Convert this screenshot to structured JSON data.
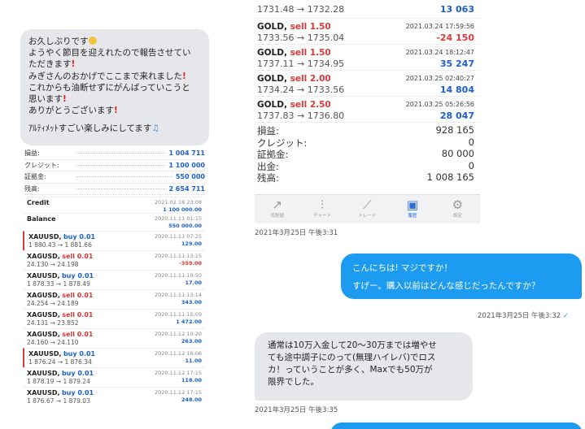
{
  "left_message": {
    "lines": [
      {
        "text": "お久しぶりです",
        "suffix": "smile"
      },
      {
        "text": "ようやく節目を迎えれたので報告させてい"
      },
      {
        "text": "ただきます",
        "suffix": "bang"
      },
      {
        "text": "みぎさんのおかげでここまで来れました",
        "suffix": "bang"
      },
      {
        "text": "これからも油断せずにがんばっていこうと"
      },
      {
        "text": "思います",
        "suffix": "bang"
      },
      {
        "text": "ありがとうございます",
        "suffix": "bang"
      },
      {
        "text": ""
      },
      {
        "text": "ｱﾙﾃｨﾒｯﾄすごい楽しみにしてます",
        "suffix": "note"
      }
    ]
  },
  "left_summary": [
    {
      "label": "損益:",
      "value": "1 004 711"
    },
    {
      "label": "クレジット:",
      "value": "1 100 000"
    },
    {
      "label": "証拠金:",
      "value": "550 000"
    },
    {
      "label": "残高:",
      "value": "2 654 711"
    }
  ],
  "left_history": [
    {
      "name": "Credit",
      "action": "",
      "action_color": "",
      "sub": "",
      "date": "2021.02.18 23:08",
      "amount": "1 100 000.00",
      "amount_color": "blue",
      "marked": false
    },
    {
      "name": "Balance",
      "action": "",
      "action_color": "",
      "sub": "",
      "date": "2020.11.11 01:15",
      "amount": "550 000.00",
      "amount_color": "blue",
      "marked": false
    },
    {
      "name": "XAUUSD,",
      "action": "buy 0.01",
      "action_color": "blue",
      "sub": "1 880.43 → 1 881.66",
      "date": "2020.11.11 07:25",
      "amount": "129.00",
      "amount_color": "blue",
      "marked": true
    },
    {
      "name": "XAGUSD,",
      "action": "sell 0.01",
      "action_color": "red",
      "sub": "24.130 → 24.198",
      "date": "2020.11.11 13:15",
      "amount": "-359.00",
      "amount_color": "red",
      "marked": false
    },
    {
      "name": "XAUUSD,",
      "action": "buy 0.01",
      "action_color": "blue",
      "sub": "1 878.33 → 1 878.49",
      "date": "2020.11.11 19:50",
      "amount": "17.00",
      "amount_color": "blue",
      "marked": false
    },
    {
      "name": "XAGUSD,",
      "action": "sell 0.01",
      "action_color": "red",
      "sub": "24.254 → 24.189",
      "date": "2020.11.11 13:14",
      "amount": "343.00",
      "amount_color": "blue",
      "marked": false
    },
    {
      "name": "XAGUSD,",
      "action": "sell 0.01",
      "action_color": "red",
      "sub": "24.131 → 23.852",
      "date": "2020.11.11 15:09",
      "amount": "1 472.00",
      "amount_color": "blue",
      "marked": false
    },
    {
      "name": "XAGUSD,",
      "action": "sell 0.01",
      "action_color": "red",
      "sub": "24.160 → 24.110",
      "date": "2020.11.12 10:20",
      "amount": "263.00",
      "amount_color": "blue",
      "marked": false
    },
    {
      "name": "XAUUSD,",
      "action": "buy 0.01",
      "action_color": "blue",
      "sub": "1 876.24 → 1 876.34",
      "date": "2020.11.12 16:06",
      "amount": "11.00",
      "amount_color": "blue",
      "marked": true
    },
    {
      "name": "XAUUSD,",
      "action": "buy 0.01",
      "action_color": "blue",
      "sub": "1 878.19 → 1 879.24",
      "date": "2020.11.12 17:15",
      "amount": "118.00",
      "amount_color": "blue",
      "marked": false
    },
    {
      "name": "XAUUSD,",
      "action": "buy 0.01",
      "action_color": "blue",
      "sub": "1 876.67 → 1 879.03",
      "date": "2020.11.12 17:15",
      "amount": "248.00",
      "amount_color": "blue",
      "marked": false
    }
  ],
  "mt4": {
    "first_row": {
      "prices": "1731.48 → 1732.28",
      "amount": "13 063"
    },
    "positions": [
      {
        "symbol": "GOLD,",
        "action": "sell 1.50",
        "prices": "1733.56 → 1735.04",
        "date": "2021.03.24 17:59:56",
        "amount": "-24 150",
        "amount_color": "red"
      },
      {
        "symbol": "GOLD,",
        "action": "sell 1.50",
        "prices": "1737.11 → 1734.95",
        "date": "2021.03.24 18:12:47",
        "amount": "35 247",
        "amount_color": "blue"
      },
      {
        "symbol": "GOLD,",
        "action": "sell 2.00",
        "prices": "1734.24 → 1733.56",
        "date": "2021.03.25 02:40:27",
        "amount": "14 804",
        "amount_color": "blue"
      },
      {
        "symbol": "GOLD,",
        "action": "sell 2.50",
        "prices": "1737.83 → 1736.80",
        "date": "2021.03.25 05:26:56",
        "amount": "28 047",
        "amount_color": "blue"
      }
    ],
    "balance": [
      {
        "label": "損益:",
        "value": "928 165"
      },
      {
        "label": "クレジット:",
        "value": "0"
      },
      {
        "label": "証拠金:",
        "value": "80 000"
      },
      {
        "label": "出金:",
        "value": "0"
      },
      {
        "label": "残高:",
        "value": "1 008 165"
      }
    ],
    "tabs": [
      {
        "label": "気配値",
        "icon": "↗",
        "icon_name": "quotes-icon",
        "active": false
      },
      {
        "label": "チャート",
        "icon": "⫶",
        "icon_name": "chart-icon",
        "active": false
      },
      {
        "label": "トレード",
        "icon": "⟋",
        "icon_name": "trade-icon",
        "active": false
      },
      {
        "label": "履歴",
        "icon": "▣",
        "icon_name": "history-icon",
        "active": true
      },
      {
        "label": "設定",
        "icon": "⚙",
        "icon_name": "gear-icon",
        "active": false
      }
    ]
  },
  "chat": {
    "timestamp1": "2021年3月25日 午後3:31",
    "blue_line1": "こんにちは!  マジですか！",
    "blue_line2": "すげー。購入以前はどんな感じだったんですか？",
    "timestamp2": "2021年3月25日 午後3:32",
    "read_mark": "✓",
    "gray_lines": [
      "通常は10万入金して20～30万までは増やせ",
      "ても途中調子にのって(無理ハイレバ)でロス",
      "カ！っていうことが多く、Maxでも50万が",
      "限界でした。"
    ],
    "timestamp3": "2021年3月25日 午後3:35"
  },
  "colors": {
    "accent": "#1d9bf0",
    "profit": "#1c5fcc",
    "loss": "#d83a36",
    "bubble_gray": "#e6e7ea"
  }
}
